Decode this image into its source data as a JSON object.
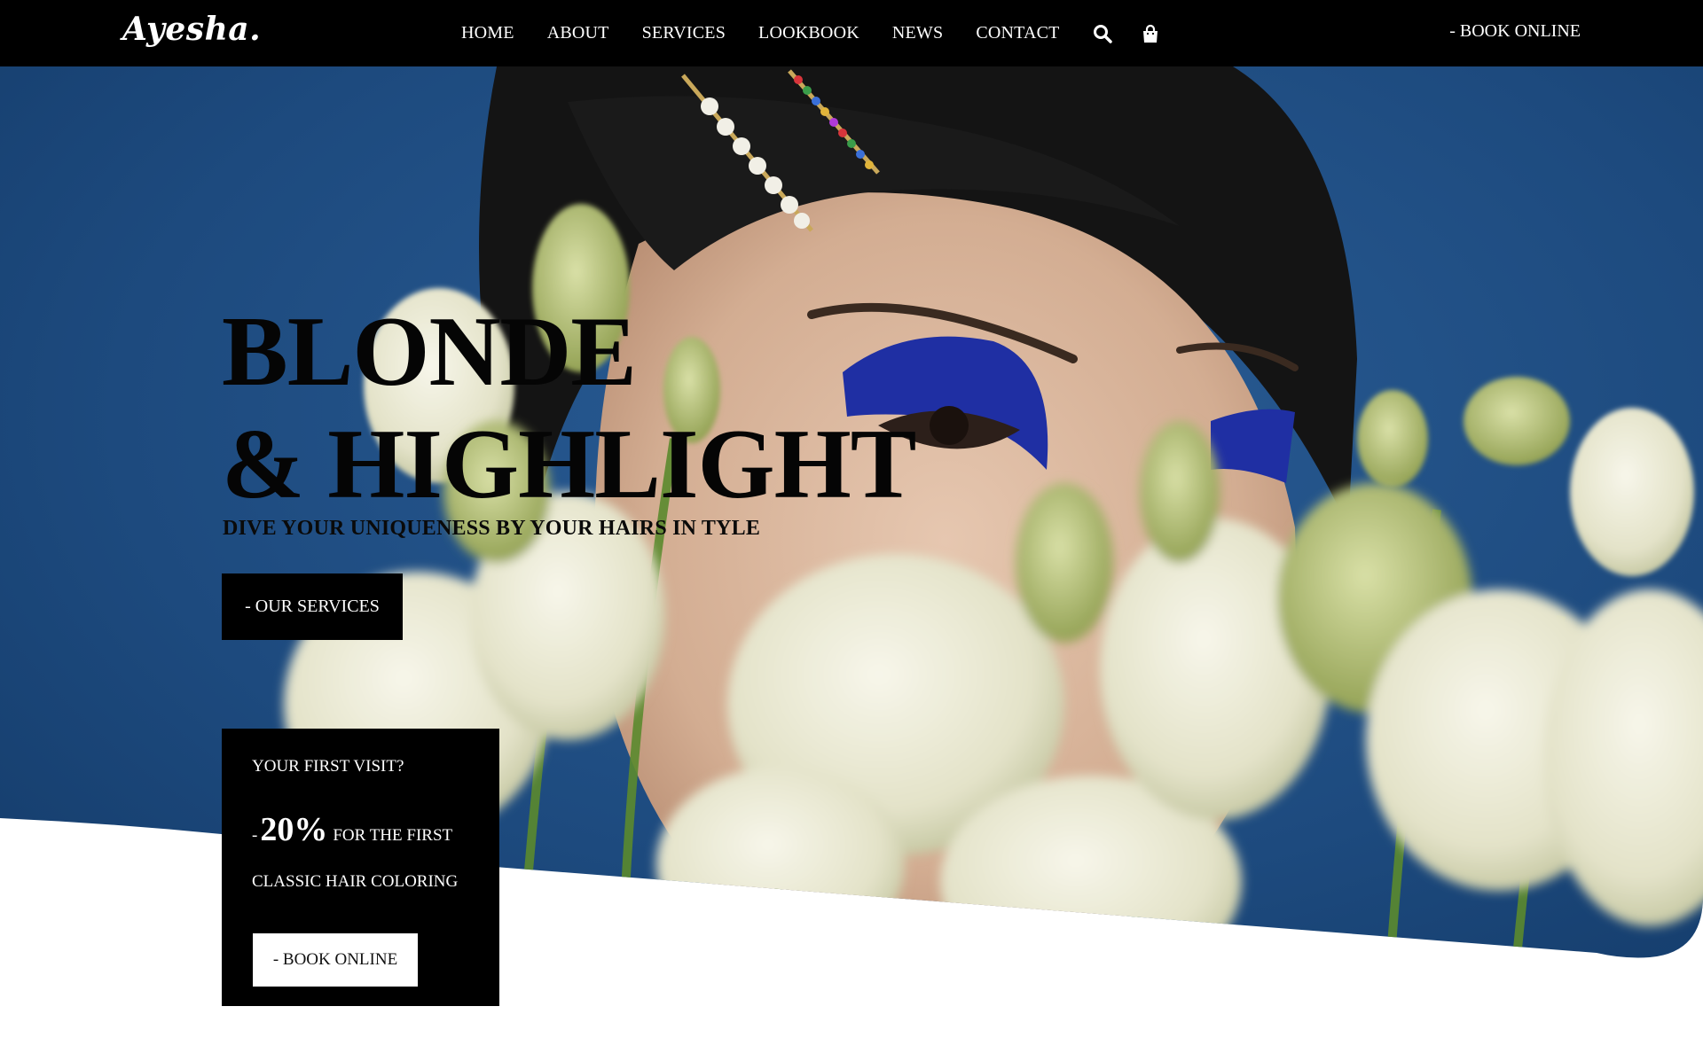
{
  "header": {
    "logo": "Ayesha.",
    "nav": [
      "HOME",
      "ABOUT",
      "SERVICES",
      "LOOKBOOK",
      "NEWS",
      "CONTACT"
    ],
    "icons": [
      "search-icon",
      "shopping-bag-icon"
    ],
    "book_label": "- BOOK ONLINE"
  },
  "hero": {
    "title_line1": "BLONDE",
    "title_line2": "& HIGHLIGHT",
    "subtitle": "DIVE YOUR UNIQUENESS BY YOUR HAIRS IN TYLE",
    "cta_label": "- OUR SERVICES",
    "image_description_icons": [
      "hair-clip",
      "flowers"
    ]
  },
  "promo": {
    "question": "YOUR FIRST VISIT?",
    "dash": "-",
    "percent": "20%",
    "line1_tail": "FOR THE FIRST",
    "line2": "CLASSIC HAIR COLORING",
    "button_label": "- BOOK ONLINE"
  },
  "colors": {
    "nav_bg": "#000000",
    "hero_blue": "#1e4f86",
    "eyeshadow": "#1f2fa3",
    "text_dark": "#050505",
    "white": "#ffffff"
  }
}
